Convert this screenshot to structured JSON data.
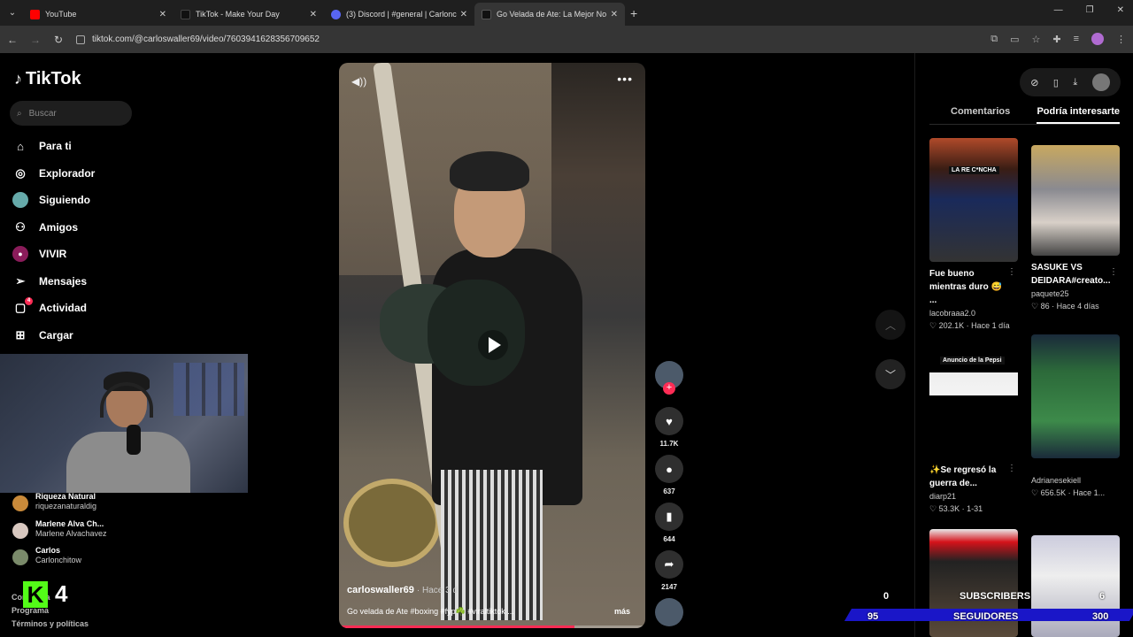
{
  "browser": {
    "tabs": [
      {
        "title": "YouTube",
        "color": "#ff0000",
        "active": false
      },
      {
        "title": "TikTok - Make Your Day",
        "color": "#000000",
        "active": false
      },
      {
        "title": "(3) Discord | #general | Carlonc",
        "color": "#5865f2",
        "active": false
      },
      {
        "title": "Go Velada de Ate: La Mejor No",
        "color": "#000000",
        "active": true
      }
    ],
    "url": "tiktok.com/@carloswaller69/video/7603941628356709652"
  },
  "sidebar": {
    "logo": "TikTok",
    "search_placeholder": "Buscar",
    "nav": [
      {
        "label": "Para ti",
        "icon": "home-icon"
      },
      {
        "label": "Explorador",
        "icon": "compass-icon"
      },
      {
        "label": "Siguiendo",
        "icon": "following-avatar-icon"
      },
      {
        "label": "Amigos",
        "icon": "friends-icon"
      },
      {
        "label": "VIVIR",
        "icon": "live-icon"
      },
      {
        "label": "Mensajes",
        "icon": "send-icon"
      },
      {
        "label": "Actividad",
        "icon": "activity-icon",
        "badge": "4"
      },
      {
        "label": "Cargar",
        "icon": "upload-icon"
      }
    ],
    "following": [
      {
        "name": "Riqueza Natural",
        "handle": "riquezanaturaldig",
        "color": "#c98a3a"
      },
      {
        "name": "Marlene Alva Ch...",
        "handle": "Marlene Alvachavez",
        "color": "#d8c8c0"
      },
      {
        "name": "Carlos",
        "handle": "Carlonchitow",
        "color": "#7a8a6a"
      }
    ],
    "footer": [
      "Compañía",
      "Programa",
      "Términos y políticas"
    ]
  },
  "video": {
    "author": "carloswaller69",
    "time": "Hace 3 d",
    "description": "Go velada de Ate #boxing #fyp☘️ #viraltiktok ...",
    "more": "más",
    "progress": 0.77
  },
  "actions": {
    "likes": "11.7K",
    "comments": "637",
    "saves": "644",
    "shares": "2147"
  },
  "right_panel": {
    "tabs": [
      "Comentarios",
      "Podría interesarte"
    ],
    "active_tab": "Podría interesarte",
    "cards": [
      {
        "caption": "Fue bueno mientras duro 😅 ...",
        "user": "lacobraaa2.0",
        "likes": "202.1K",
        "time": "Hace 1 día",
        "label": "LA RE C*NCHA"
      },
      {
        "caption": "SASUKE VS DEIDARA#creato...",
        "user": "paquete25",
        "likes": "86",
        "time": "Hace 4 días"
      },
      {
        "caption": "✨Se regresó la guerra de...",
        "user": "diarp21",
        "likes": "53.3K",
        "time": "1-31",
        "label": "Anuncio de la Pepsi"
      },
      {
        "caption": "",
        "user": "Adrianesekiell",
        "likes": "656.5K",
        "time": "Hace 1...",
        "label": ""
      },
      {
        "caption": "",
        "user": "",
        "likes": "",
        "time": "",
        "label": ""
      },
      {
        "caption": "",
        "user": "",
        "likes": "",
        "time": "",
        "label": ""
      }
    ]
  },
  "overlay": {
    "kick_count": "4",
    "subs_label": "SUBSCRIBERS",
    "subs_value": "6",
    "subs_left": "0",
    "followers_label": "SEGUIDORES",
    "followers_value": "300",
    "followers_left": "95"
  }
}
